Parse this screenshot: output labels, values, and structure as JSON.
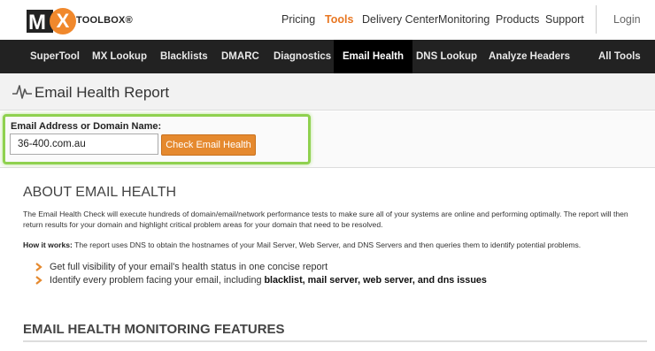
{
  "logo": {
    "mark": "M",
    "x_letter": "X",
    "wordmark": "TOOLBOX®"
  },
  "top_nav": {
    "pricing": "Pricing",
    "tools": "Tools",
    "delivery_center": "Delivery Center",
    "monitoring": "Monitoring",
    "products": "Products",
    "support": "Support",
    "login": "Login"
  },
  "tool_nav": {
    "supertool": "SuperTool",
    "mx_lookup": "MX Lookup",
    "blacklists": "Blacklists",
    "dmarc": "DMARC",
    "diagnostics": "Diagnostics",
    "email_health": "Email Health",
    "dns_lookup": "DNS Lookup",
    "analyze_headers": "Analyze Headers",
    "all_tools": "All Tools"
  },
  "page": {
    "title": "Email Health Report"
  },
  "form": {
    "label": "Email Address or Domain Name:",
    "input_value": "36-400.com.au",
    "button_label": "Check Email Health"
  },
  "about": {
    "title": "ABOUT EMAIL HEALTH",
    "paragraph": "The Email Health Check will execute hundreds of domain/email/network performance tests to make sure all of your systems are online and performing optimally. The report will then return results for your domain and highlight critical problem areas for your domain that need to be resolved.",
    "how_label": "How it works:",
    "how_text": " The report uses DNS to obtain the hostnames of your Mail Server, Web Server, and DNS Servers and then queries them to identify potential problems.",
    "bullets": [
      {
        "text": "Get full visibility of your email's health status in one concise report",
        "bold": ""
      },
      {
        "text": "Identify every problem facing your email, including ",
        "bold": "blacklist, mail server, web server, and dns issues"
      }
    ]
  },
  "features": {
    "title": "EMAIL HEALTH MONITORING FEATURES"
  },
  "colors": {
    "accent": "#e87722",
    "nav_bg": "#222222",
    "highlight": "#8fd14f",
    "button": "#e5892e"
  },
  "icons": [
    "pulse-icon",
    "chevron-right-icon"
  ]
}
